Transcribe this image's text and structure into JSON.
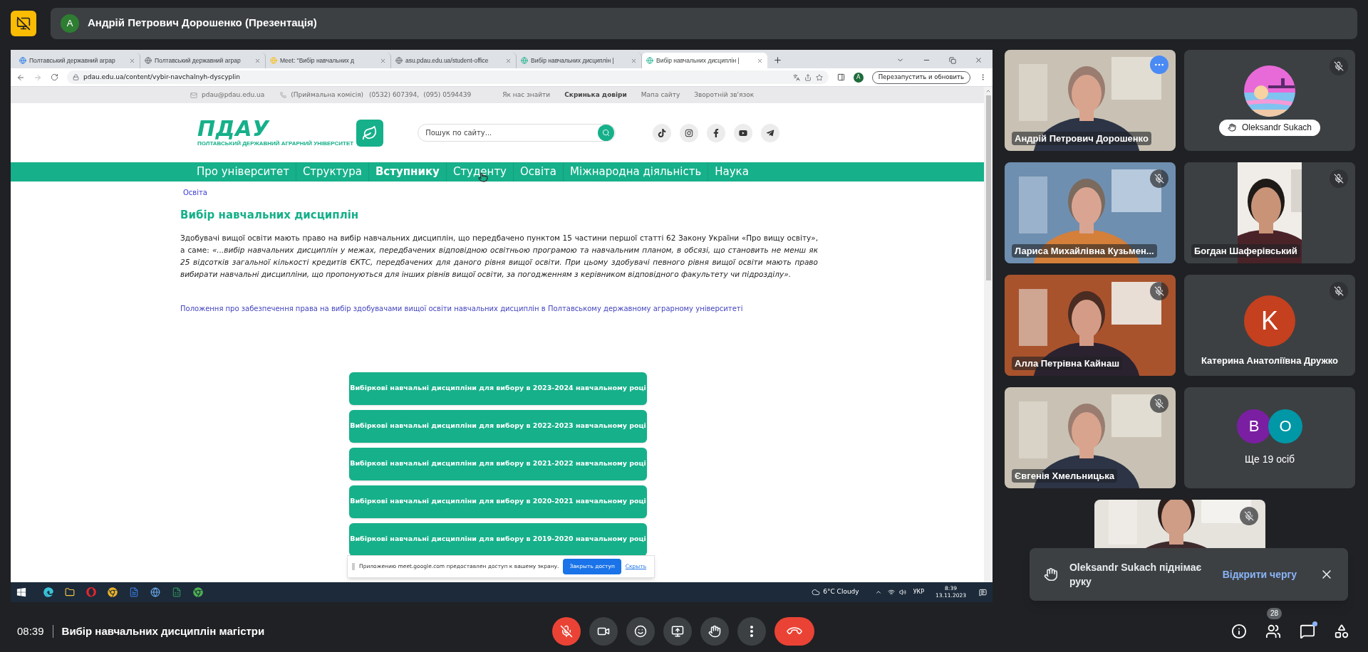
{
  "top_bar": {
    "presenter_initial": "А",
    "presenter_label": "Андрій Петрович Дорошенко (Презентація)"
  },
  "shared_screen": {
    "browser": {
      "tabs": [
        {
          "title": "Полтавський державний аграр",
          "selected": false
        },
        {
          "title": "Полтавський державний аграр",
          "selected": false
        },
        {
          "title": "Meet: \"Вибір навчальних д",
          "selected": false
        },
        {
          "title": "asu.pdau.edu.ua/student-office",
          "selected": false
        },
        {
          "title": "Вибір навчальних дисциплін |",
          "selected": false
        },
        {
          "title": "Вибір навчальних дисциплін |",
          "selected": true
        }
      ],
      "url": "pdau.edu.ua/content/vybir-navchalnyh-dyscyplin",
      "profile_initial": "A",
      "update_button": "Перезапустить и обновить"
    },
    "site": {
      "contact_bar": {
        "email": "pdau@pdau.edu.ua",
        "admissions_label": "(Приймальна комісія)",
        "phone_1": "(0532) 607394,",
        "phone_2": "(095) 0594439",
        "links": [
          {
            "label": "Як нас знайти",
            "bold": false
          },
          {
            "label": "Скринька довіри",
            "bold": true
          },
          {
            "label": "Мапа сайту",
            "bold": false
          },
          {
            "label": "Зворотній зв'язок",
            "bold": false
          }
        ]
      },
      "logo": {
        "text": "ПДАУ",
        "subtitle": "ПОЛТАВСЬКИЙ ДЕРЖАВНИЙ АГРАРНИЙ УНІВЕРСИТЕТ"
      },
      "search_placeholder": "Пошук по сайту...",
      "nav": [
        {
          "label": "Про університет",
          "selected": false
        },
        {
          "label": "Структура",
          "selected": false
        },
        {
          "label": "Вступнику",
          "selected": true
        },
        {
          "label": "Студенту",
          "selected": false
        },
        {
          "label": "Освіта",
          "selected": false
        },
        {
          "label": "Міжнародна діяльність",
          "selected": false
        },
        {
          "label": "Наука",
          "selected": false
        }
      ],
      "breadcrumb": "Освіта",
      "heading": "Вибір навчальних дисциплін",
      "intro": "Здобувачі вищої освіти мають право на вибір навчальних дисциплін, що передбачено пунктом 15 частини першої статті 62 Закону України «Про вищу освіту», а саме: *«...вибір навчальних дисциплін у межах, передбачених відповідною освітньою програмою та навчальним планом, в обсязі, що становить не менш як 25 відсотків загальної кількості кредитів ЄКТС, передбачених для даного рівня вищої освіти. При цьому здобувачі певного рівня вищої освіти мають право вибирати навчальні дисципліни, що пропонуються для інших рівнів вищої освіти, за погодженням з керівником відповідного факультету чи підрозділу».*",
      "regulation_link": "Положення про забезпечення права на вибір здобувачами вищої освіти навчальних дисциплін в Полтавському державному аграрному університеті",
      "year_buttons": [
        "Вибіркові навчальні дисципліни для вибору в 2023-2024 навчальному році",
        "Вибіркові навчальні дисципліни для вибору в 2022-2023 навчальному році",
        "Вибіркові навчальні дисципліни для вибору в 2021-2022 навчальному році",
        "Вибіркові навчальні дисципліни для вибору в 2020-2021 навчальному році",
        "Вибіркові навчальні дисципліни для вибору в 2019-2020 навчальному році"
      ]
    },
    "share_notice": {
      "text": "Приложению meet.google.com предоставлен доступ к вашему экрану.",
      "stop_button": "Закрыть доступ",
      "hide_link": "Скрыть"
    },
    "taskbar": {
      "weather": "6°C Cloudy",
      "language": "УКР",
      "time": "8:39",
      "date": "13.11.2023"
    }
  },
  "tiles": [
    {
      "kind": "video",
      "name": "Андрій Петрович Дорошенко",
      "muted": false,
      "highlighted": true
    },
    {
      "kind": "avatar_picture",
      "name": "Oleksandr Sukach",
      "muted": true,
      "highlighted": false,
      "hand_raised": true
    },
    {
      "kind": "video",
      "name": "Лариса Михайлівна Кузьмен...",
      "muted": true,
      "highlighted": false
    },
    {
      "kind": "video",
      "name": "Богдан Шаферівський",
      "muted": true,
      "highlighted": false,
      "portrait": true
    },
    {
      "kind": "video",
      "name": "Алла Петрівна Кайнаш",
      "muted": true,
      "highlighted": false
    },
    {
      "kind": "avatar",
      "name": "Катерина Анатоліївна Дружко",
      "letter": "K",
      "color": "#c5401e",
      "muted": true,
      "highlighted": false
    },
    {
      "kind": "video",
      "name": "Євгенія Хмельницька",
      "muted": true,
      "highlighted": false
    },
    {
      "kind": "others",
      "label": "Ще 19 осіб",
      "avatars": [
        {
          "letter": "B",
          "color": "#7b1fa2"
        },
        {
          "letter": "O",
          "color": "#0097a7"
        }
      ],
      "highlighted": false
    }
  ],
  "partial_tile": {
    "kind": "video",
    "muted": true
  },
  "notification": {
    "text": "Oleksandr Sukach піднімає руку",
    "action": "Відкрити чергу"
  },
  "bottom_bar": {
    "time": "08:39",
    "meeting_title": "Вибір навчальних дисциплін магістри",
    "mic_muted": true,
    "people_count": "28",
    "chat_unread": true
  }
}
